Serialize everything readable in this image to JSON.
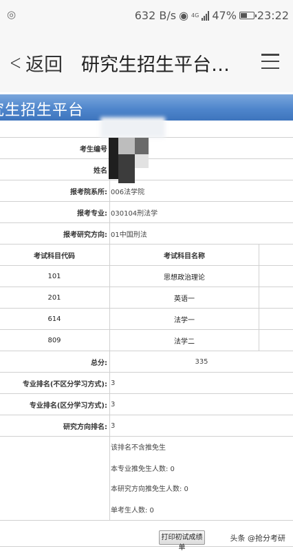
{
  "status_bar": {
    "left_icon": "hotspot-icon",
    "net_speed": "632 B/s",
    "network_type": "4G",
    "battery_percent": "47%",
    "time": "23:22"
  },
  "nav": {
    "back_label": "返回",
    "title": "研究生招生平台…"
  },
  "banner": {
    "title": "究生招生平台"
  },
  "info": {
    "rows": [
      {
        "label": "考生编号",
        "value": ""
      },
      {
        "label": "姓名",
        "value": ""
      },
      {
        "label": "报考院系所:",
        "value": "006法学院"
      },
      {
        "label": "报考专业:",
        "value": "030104刑法学"
      },
      {
        "label": "报考研究方向:",
        "value": "01中国刑法"
      }
    ]
  },
  "subjects": {
    "header_code": "考试科目代码",
    "header_name": "考试科目名称",
    "rows": [
      {
        "code": "101",
        "name": "思想政治理论"
      },
      {
        "code": "201",
        "name": "英语一"
      },
      {
        "code": "614",
        "name": "法学一"
      },
      {
        "code": "809",
        "name": "法学二"
      }
    ]
  },
  "total": {
    "label": "总分:",
    "value": "335"
  },
  "rankings": [
    {
      "label": "专业排名(不区分学习方式):",
      "value": "3"
    },
    {
      "label": "专业排名(区分学习方式):",
      "value": "3"
    },
    {
      "label": "研究方向排名:",
      "value": "3"
    }
  ],
  "notes": [
    "该排名不含推免生",
    "本专业推免生人数: 0",
    "本研究方向推免生人数: 0",
    "单考生人数: 0"
  ],
  "print_button": "打印初试成绩单",
  "watermark": "头条 @抢分考研"
}
